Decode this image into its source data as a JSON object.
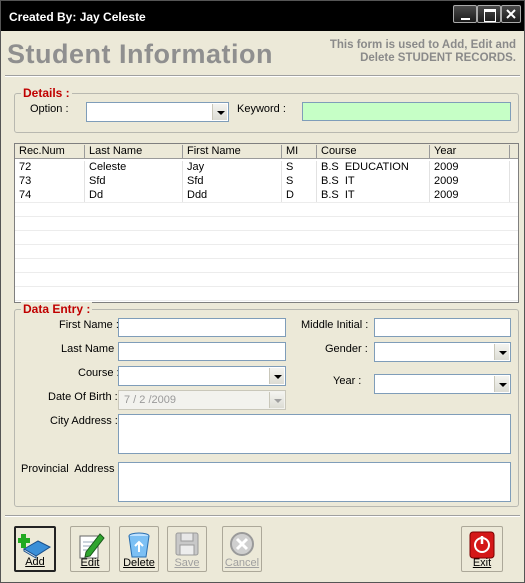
{
  "window": {
    "title": "Created By: Jay Celeste"
  },
  "header": {
    "title": "Student Information",
    "description_line1": "This form is used to Add, Edit and",
    "description_line2": "Delete STUDENT RECORDS."
  },
  "details": {
    "legend": "Details :",
    "option_label": "Option :",
    "option_value": "",
    "keyword_label": "Keyword :",
    "keyword_value": ""
  },
  "grid": {
    "columns": [
      "Rec.Num",
      "Last Name",
      "First Name",
      "MI",
      "Course",
      "Year"
    ],
    "rows": [
      [
        "72",
        "Celeste",
        "Jay",
        "S",
        "B.S  EDUCATION",
        "2009"
      ],
      [
        "73",
        "Sfd",
        "Sfd",
        "S",
        "B.S  IT",
        "2009"
      ],
      [
        "74",
        "Dd",
        "Ddd",
        "D",
        "B.S  IT",
        "2009"
      ]
    ]
  },
  "data_entry": {
    "legend": "Data Entry :",
    "first_name_label": "First Name :",
    "last_name_label": "Last Name :",
    "course_label": "Course :",
    "dob_label": "Date Of Birth :",
    "dob_value": "7 / 2 /2009",
    "city_label": "City Address :",
    "provincial_label": "Provincial  Address :",
    "middle_initial_label": "Middle Initial :",
    "gender_label": "Gender :",
    "year_label": "Year :"
  },
  "toolbar": {
    "add": "Add",
    "edit": "Edit",
    "delete": "Delete",
    "save": "Save",
    "cancel": "Cancel",
    "exit": "Exit"
  },
  "colors": {
    "legend_red": "#c00000",
    "keyword_bg": "#c6ffc6",
    "form_bg": "#ece9d8"
  }
}
